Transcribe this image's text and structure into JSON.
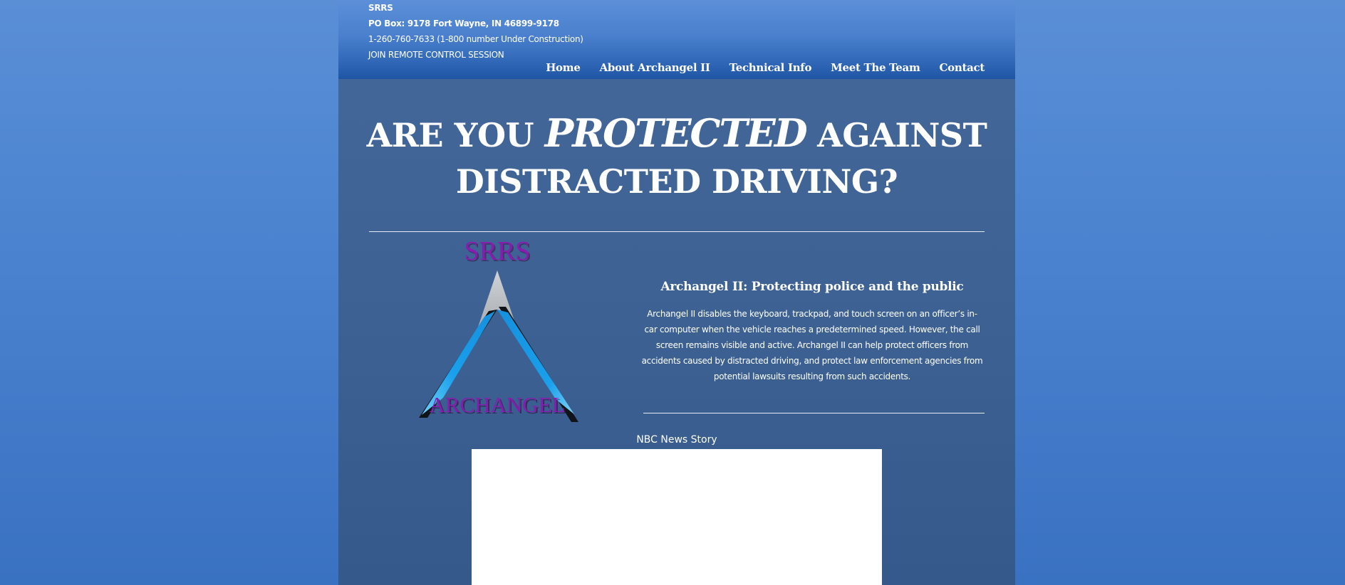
{
  "header": {
    "company": "SRRS",
    "address": "PO Box: 9178 Fort Wayne, IN 46899-9178",
    "phone": "1-260-760-7633 (1-800 number Under Construction)",
    "remote_link": "JOIN REMOTE CONTROL SESSION"
  },
  "nav": {
    "items": [
      {
        "label": "Home"
      },
      {
        "label": "About Archangel II"
      },
      {
        "label": "Technical Info"
      },
      {
        "label": "Meet The Team"
      },
      {
        "label": "Contact"
      }
    ]
  },
  "hero": {
    "part1": "ARE YOU ",
    "emphasis": "PROTECTED",
    "part2": " AGAINST",
    "line2": "DISTRACTED DRIVING?"
  },
  "logo": {
    "top_text": "SRRS",
    "bottom_text": "ARCHANGEL",
    "text_color": "#8a1bb0",
    "blue": "#1aa0ec",
    "silver": "#b8bcc2"
  },
  "feature": {
    "title": "Archangel II: Protecting police and the public",
    "body": "Archangel II disables the keyboard, trackpad, and touch screen on an officer’s in-car computer when the vehicle reaches a predetermined speed. However, the call screen remains visible and active. Archangel II can help protect officers from accidents caused by distracted driving, and protect law enforcement agencies from potential lawsuits resulting from such accidents."
  },
  "video": {
    "label": "NBC News Story"
  }
}
